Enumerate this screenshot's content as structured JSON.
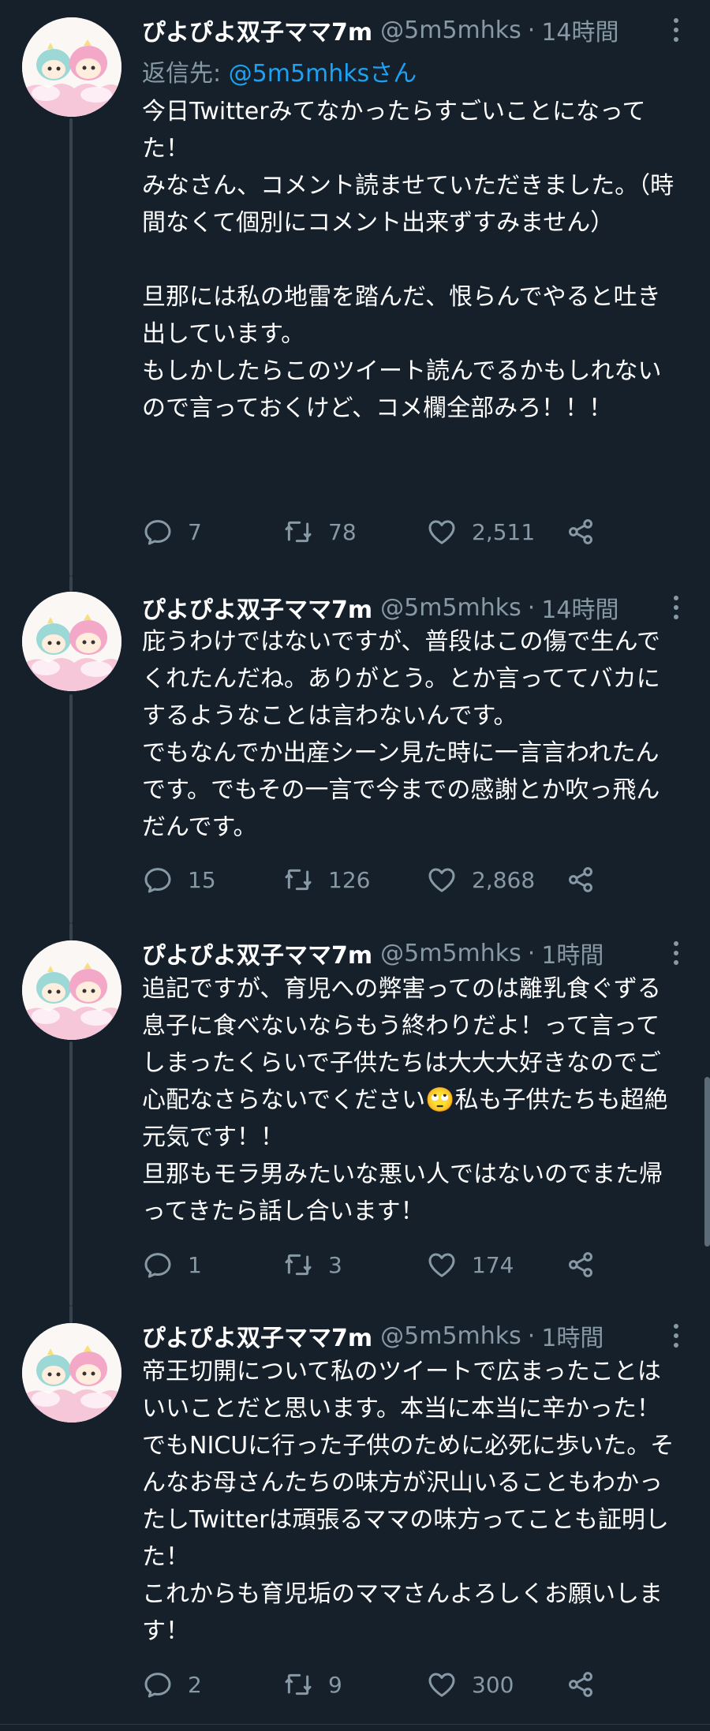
{
  "colors": {
    "background": "#15202b",
    "text": "#ffffff",
    "muted": "#8899a6",
    "accent": "#1da1f2",
    "thread_line": "#38444d"
  },
  "tweets": [
    {
      "display_name": "ぴよぴよ双子ママ7m",
      "handle": "@5m5mhks",
      "separator": "·",
      "time": "14時間",
      "reply_to_label": "返信先: ",
      "reply_to_mention": "@5m5mhksさん",
      "text": "今日Twitterみてなかったらすごいことになってた！\nみなさん、コメント読ませていただきました。（時間なくて個別にコメント出来ずすみません）\n\n旦那には私の地雷を踏んだ、恨らんでやると吐き出しています。\nもしかしたらこのツイート読んでるかもしれないので言っておくけど、コメ欄全部みろ！！！",
      "replies": "7",
      "retweets": "78",
      "likes": "2,511",
      "icons": [
        "avatar",
        "more-icon",
        "reply-icon",
        "retweet-icon",
        "like-icon",
        "share-icon"
      ]
    },
    {
      "display_name": "ぴよぴよ双子ママ7m",
      "handle": "@5m5mhks",
      "separator": "·",
      "time": "14時間",
      "text": "庇うわけではないですが、普段はこの傷で生んでくれたんだね。ありがとう。とか言っててバカにするようなことは言わないんです。\nでもなんでか出産シーン見た時に一言言われたんです。でもその一言で今までの感謝とか吹っ飛んだんです。",
      "replies": "15",
      "retweets": "126",
      "likes": "2,868"
    },
    {
      "display_name": "ぴよぴよ双子ママ7m",
      "handle": "@5m5mhks",
      "separator": "·",
      "time": "1時間",
      "text": "追記ですが、育児への弊害ってのは離乳食ぐずる息子に食べないならもう終わりだよ！って言ってしまったくらいで子供たちは大大大好きなのでご心配なさらないでください🙄私も子供たちも超絶元気です！！\n旦那もモラ男みたいな悪い人ではないのでまた帰ってきたら話し合います！",
      "replies": "1",
      "retweets": "3",
      "likes": "174"
    },
    {
      "display_name": "ぴよぴよ双子ママ7m",
      "handle": "@5m5mhks",
      "separator": "·",
      "time": "1時間",
      "text": "帝王切開について私のツイートで広まったことはいいことだと思います。本当に本当に辛かった！でもNICUに行った子供のために必死に歩いた。そんなお母さんたちの味方が沢山いることもわかったしTwitterは頑張るママの味方ってことも証明した！\nこれからも育児垢のママさんよろしくお願いします！",
      "replies": "2",
      "retweets": "9",
      "likes": "300"
    }
  ]
}
